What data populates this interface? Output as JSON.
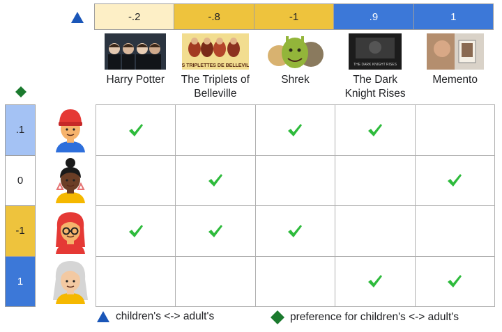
{
  "movie_scale": [
    {
      "value": "-.2",
      "color": "#FDEFC6",
      "text_color": "#202124"
    },
    {
      "value": "-.8",
      "color": "#EEC33D",
      "text_color": "#202124"
    },
    {
      "value": "-1",
      "color": "#EEC33D",
      "text_color": "#202124"
    },
    {
      "value": ".9",
      "color": "#3C78D8",
      "text_color": "#ffffff"
    },
    {
      "value": "1",
      "color": "#3C78D8",
      "text_color": "#ffffff"
    }
  ],
  "movies": [
    {
      "title": "Harry Potter",
      "poster_icon": "harry-potter-poster"
    },
    {
      "title": "The Triplets of Belleville",
      "poster_icon": "triplets-of-belleville-poster",
      "poster_text": "LES TRIPLETTES DE BELLEVILLE"
    },
    {
      "title": "Shrek",
      "poster_icon": "shrek-poster"
    },
    {
      "title": "The Dark Knight Rises",
      "poster_icon": "dark-knight-rises-poster",
      "poster_text": "THE DARK KNIGHT RISES"
    },
    {
      "title": "Memento",
      "poster_icon": "memento-poster"
    }
  ],
  "user_scale": [
    {
      "value": ".1",
      "color": "#A4C2F4",
      "text_color": "#202124",
      "avatar_icon": "user-red-beanie-avatar"
    },
    {
      "value": "0",
      "color": "#ffffff",
      "text_color": "#202124",
      "avatar_icon": "user-bun-earrings-avatar"
    },
    {
      "value": "-1",
      "color": "#EEC33D",
      "text_color": "#202124",
      "avatar_icon": "user-red-hair-glasses-avatar"
    },
    {
      "value": "1",
      "color": "#3C78D8",
      "text_color": "#ffffff",
      "avatar_icon": "user-gray-hair-avatar"
    }
  ],
  "ratings": [
    [
      true,
      false,
      true,
      true,
      false
    ],
    [
      false,
      true,
      false,
      false,
      true
    ],
    [
      true,
      true,
      true,
      false,
      false
    ],
    [
      false,
      false,
      false,
      true,
      true
    ]
  ],
  "legend": {
    "triangle_label": "children's <-> adult's",
    "diamond_label": "preference for children's <-> adult's"
  },
  "colors": {
    "triangle": "#1A56B8",
    "diamond": "#1B7A2E",
    "check": "#2EBB3C"
  }
}
